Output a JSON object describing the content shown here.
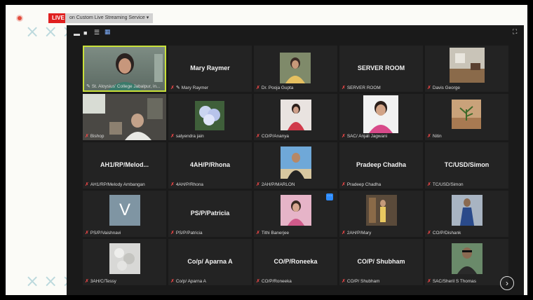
{
  "live_badge": "LIVE",
  "stream_label": "on Custom Live Streaming Service",
  "toolbar": {
    "icons": [
      "minimize-icon",
      "window-icon",
      "speaker-view-icon",
      "gallery-view-icon",
      "fullscreen-icon"
    ]
  },
  "tiles": [
    {
      "display_name": "",
      "label": "St. Aloysius' College Jabalpur, in...",
      "pinned": true,
      "muted": false
    },
    {
      "display_name": "Mary Raymer",
      "label": "Mary Raymer",
      "pinned": true,
      "muted": true
    },
    {
      "display_name": "",
      "label": "Dr. Pooja Gupta",
      "pinned": false,
      "muted": true
    },
    {
      "display_name": "SERVER ROOM",
      "label": "SERVER ROOM",
      "pinned": false,
      "muted": true
    },
    {
      "display_name": "",
      "label": "Davis George",
      "pinned": false,
      "muted": true
    },
    {
      "display_name": "",
      "label": "Bishop",
      "pinned": false,
      "muted": true
    },
    {
      "display_name": "",
      "label": "satyendra jain",
      "pinned": false,
      "muted": true
    },
    {
      "display_name": "",
      "label": "CO/P/Ananya",
      "pinned": false,
      "muted": true
    },
    {
      "display_name": "",
      "label": "SAC/ Anjali Jagwani",
      "pinned": false,
      "muted": true
    },
    {
      "display_name": "",
      "label": "Nitin",
      "pinned": false,
      "muted": true
    },
    {
      "display_name": "AH1/RP/Melod...",
      "label": "AH1/RP/Melody Ambangan",
      "pinned": false,
      "muted": true
    },
    {
      "display_name": "4AH/P/Rhona",
      "label": "4AH/P/Rhona",
      "pinned": false,
      "muted": true
    },
    {
      "display_name": "",
      "label": "2AH/P/MARLON",
      "pinned": false,
      "muted": true
    },
    {
      "display_name": "Pradeep Chadha",
      "label": "Pradeep Chadha",
      "pinned": false,
      "muted": true
    },
    {
      "display_name": "TC/USD/Simon",
      "label": "TC/USD/Simon",
      "pinned": false,
      "muted": true
    },
    {
      "display_name": "",
      "avatar_letter": "V",
      "label": "PS/P/Vaishnavi",
      "pinned": false,
      "muted": true
    },
    {
      "display_name": "PS/P/Patricia",
      "label": "PS/P/Patricia",
      "pinned": false,
      "muted": true
    },
    {
      "display_name": "",
      "label": "Tithi Banerjee",
      "pinned": false,
      "muted": true
    },
    {
      "display_name": "",
      "label": "2AH/P/Mary",
      "pinned": false,
      "muted": true
    },
    {
      "display_name": "",
      "label": "CO/P/Dishank",
      "pinned": false,
      "muted": true
    },
    {
      "display_name": "",
      "label": "3AH/C/Tessy",
      "pinned": false,
      "muted": true
    },
    {
      "display_name": "Co/p/ Aparna A",
      "label": "Co/p/ Aparna A",
      "pinned": false,
      "muted": true
    },
    {
      "display_name": "CO/P/Roneeka",
      "label": "CO/P/Roneeka",
      "pinned": false,
      "muted": true
    },
    {
      "display_name": "CO/P/ Shubham",
      "label": "CO/P/ Shubham",
      "pinned": false,
      "muted": true
    },
    {
      "display_name": "",
      "label": "SAC/Sheril S Thomas",
      "pinned": false,
      "muted": true
    }
  ],
  "colors": {
    "live_red": "#e02020",
    "active_border": "#c9e03a",
    "muted_red": "#ff4a4a",
    "accent_blue": "#2d8cff"
  }
}
